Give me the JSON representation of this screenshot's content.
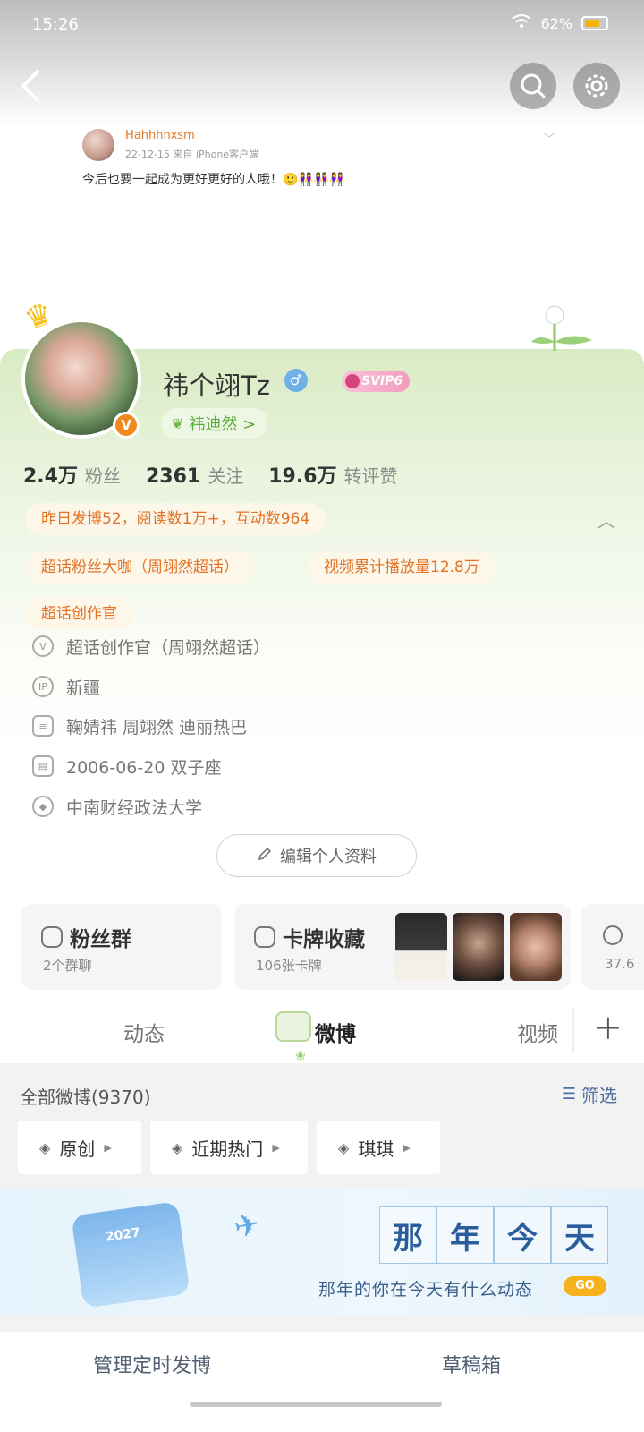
{
  "status_bar": {
    "time": "15:26",
    "battery": "62%"
  },
  "post_preview": {
    "username": "Hahhhnxsm",
    "meta": "22-12-15  来自 iPhone客户端",
    "text": "今后也要一起成为更好更好的人哦！🙂👭👭👭"
  },
  "profile": {
    "name": "祎个翊Tz",
    "verified": "V",
    "svip": "SVIP6",
    "alias": "祎迪然 >",
    "stats": [
      {
        "value": "2.4万",
        "label": "粉丝"
      },
      {
        "value": "2361",
        "label": "关注"
      },
      {
        "value": "19.6万",
        "label": "转评赞"
      }
    ],
    "tags": {
      "yesterday": "昨日发博52，阅读数1万+，互动数964",
      "super_fan": "超话粉丝大咖（周翊然超话）",
      "video_plays": "视频累计播放量12.8万",
      "creator": "超话创作官"
    },
    "info": {
      "creator_detail": "超话创作官（周翊然超话）",
      "location": "新疆",
      "interests": "鞠婧祎  周翊然  迪丽热巴",
      "birthday": "2006-06-20 双子座",
      "school": "中南财经政法大学"
    },
    "edit_button": "编辑个人资料"
  },
  "cards": {
    "fans_group": {
      "title": "粉丝群",
      "sub": "2个群聊"
    },
    "card_collection": {
      "title": "卡牌收藏",
      "sub": "106张卡牌"
    },
    "partial_sub": "37.6"
  },
  "tabs": {
    "dongtai": "动态",
    "weibo": "微博",
    "video": "视频",
    "add": "+"
  },
  "feed": {
    "title": "全部微博(9370)",
    "filter": "筛选",
    "chips": [
      "原创",
      "近期热门",
      "琪琪"
    ]
  },
  "banner": {
    "calendar_year": "2027",
    "title_chars": [
      "那",
      "年",
      "今",
      "天"
    ],
    "subtitle": "那年的你在今天有什么动态",
    "go": "GO"
  },
  "bottom_bar": {
    "scheduled": "管理定时发博",
    "drafts": "草稿箱"
  },
  "colors": {
    "accent_orange": "#e27326",
    "green": "#5aaa3a",
    "link_blue": "#4d6ea0"
  }
}
